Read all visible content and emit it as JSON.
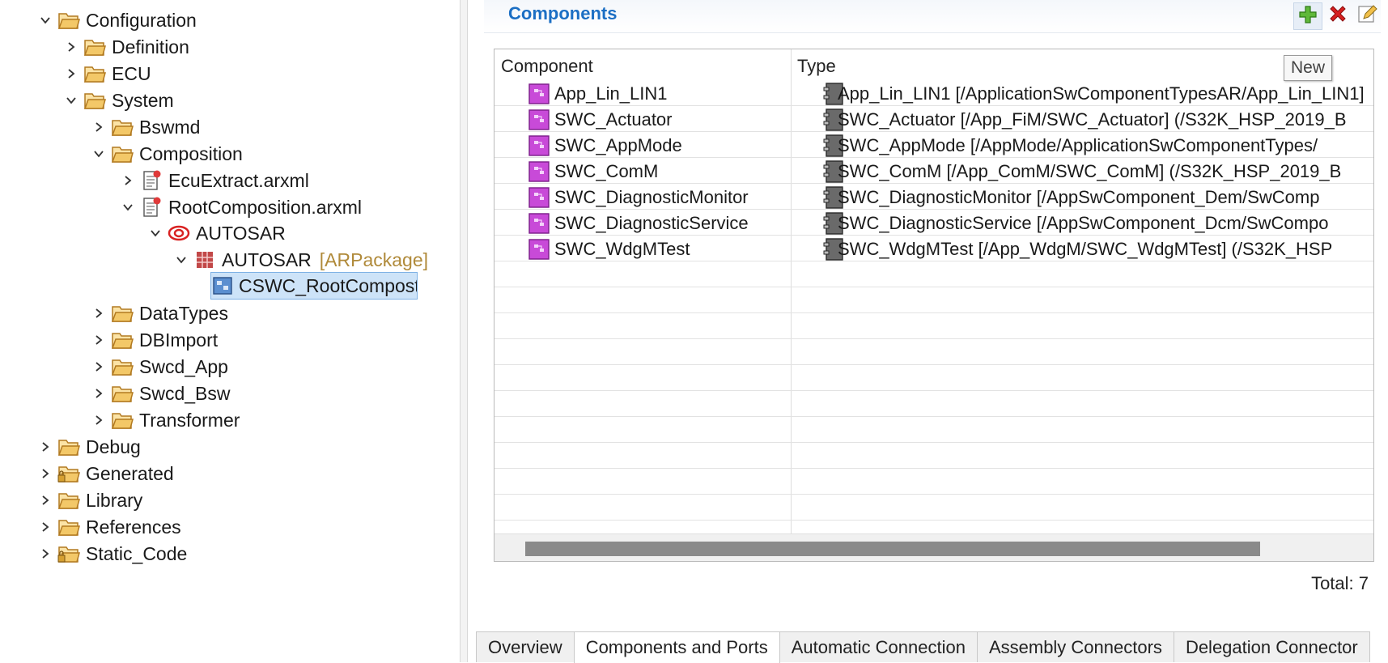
{
  "tree": {
    "configuration": "Configuration",
    "definition": "Definition",
    "ecu": "ECU",
    "system": "System",
    "bswmd": "Bswmd",
    "composition": "Composition",
    "ecu_extract": "EcuExtract.arxml",
    "root_composition": "RootComposition.arxml",
    "autosar": "AUTOSAR",
    "autosar_pkg": "AUTOSAR",
    "autosar_pkg_meta": "[ARPackage]",
    "cswc": "CSWC_RootCompostio",
    "datatypes": "DataTypes",
    "dbimport": "DBImport",
    "swcd_app": "Swcd_App",
    "swcd_bsw": "Swcd_Bsw",
    "transformer": "Transformer",
    "debug": "Debug",
    "generated": "Generated",
    "library": "Library",
    "references": "References",
    "static_code": "Static_Code"
  },
  "section": {
    "title": "Components",
    "tooltip": "New",
    "add_icon": "add-icon",
    "delete_icon": "delete-icon",
    "edit_icon": "edit-icon"
  },
  "table": {
    "headers": {
      "component": "Component",
      "type": "Type"
    },
    "rows": [
      {
        "component": "App_Lin_LIN1",
        "type": "App_Lin_LIN1 [/ApplicationSwComponentTypesAR/App_Lin_LIN1]"
      },
      {
        "component": "SWC_Actuator",
        "type": "SWC_Actuator [/App_FiM/SWC_Actuator] (/S32K_HSP_2019_B"
      },
      {
        "component": "SWC_AppMode",
        "type": "SWC_AppMode [/AppMode/ApplicationSwComponentTypes/"
      },
      {
        "component": "SWC_ComM",
        "type": "SWC_ComM [/App_ComM/SWC_ComM] (/S32K_HSP_2019_B"
      },
      {
        "component": "SWC_DiagnosticMonitor",
        "type": "SWC_DiagnosticMonitor [/AppSwComponent_Dem/SwComp"
      },
      {
        "component": "SWC_DiagnosticService",
        "type": "SWC_DiagnosticService [/AppSwComponent_Dcm/SwCompo"
      },
      {
        "component": "SWC_WdgMTest",
        "type": "SWC_WdgMTest [/App_WdgM/SWC_WdgMTest] (/S32K_HSP"
      }
    ],
    "total": "Total: 7"
  },
  "tabs": [
    "Overview",
    "Components and Ports",
    "Automatic Connection",
    "Assembly Connectors",
    "Delegation Connector"
  ],
  "colors": {
    "accent": "#1c6fc4",
    "component_icon": "#c84ad8",
    "selection": "#cde3f8",
    "folder": "#e8b24a"
  }
}
